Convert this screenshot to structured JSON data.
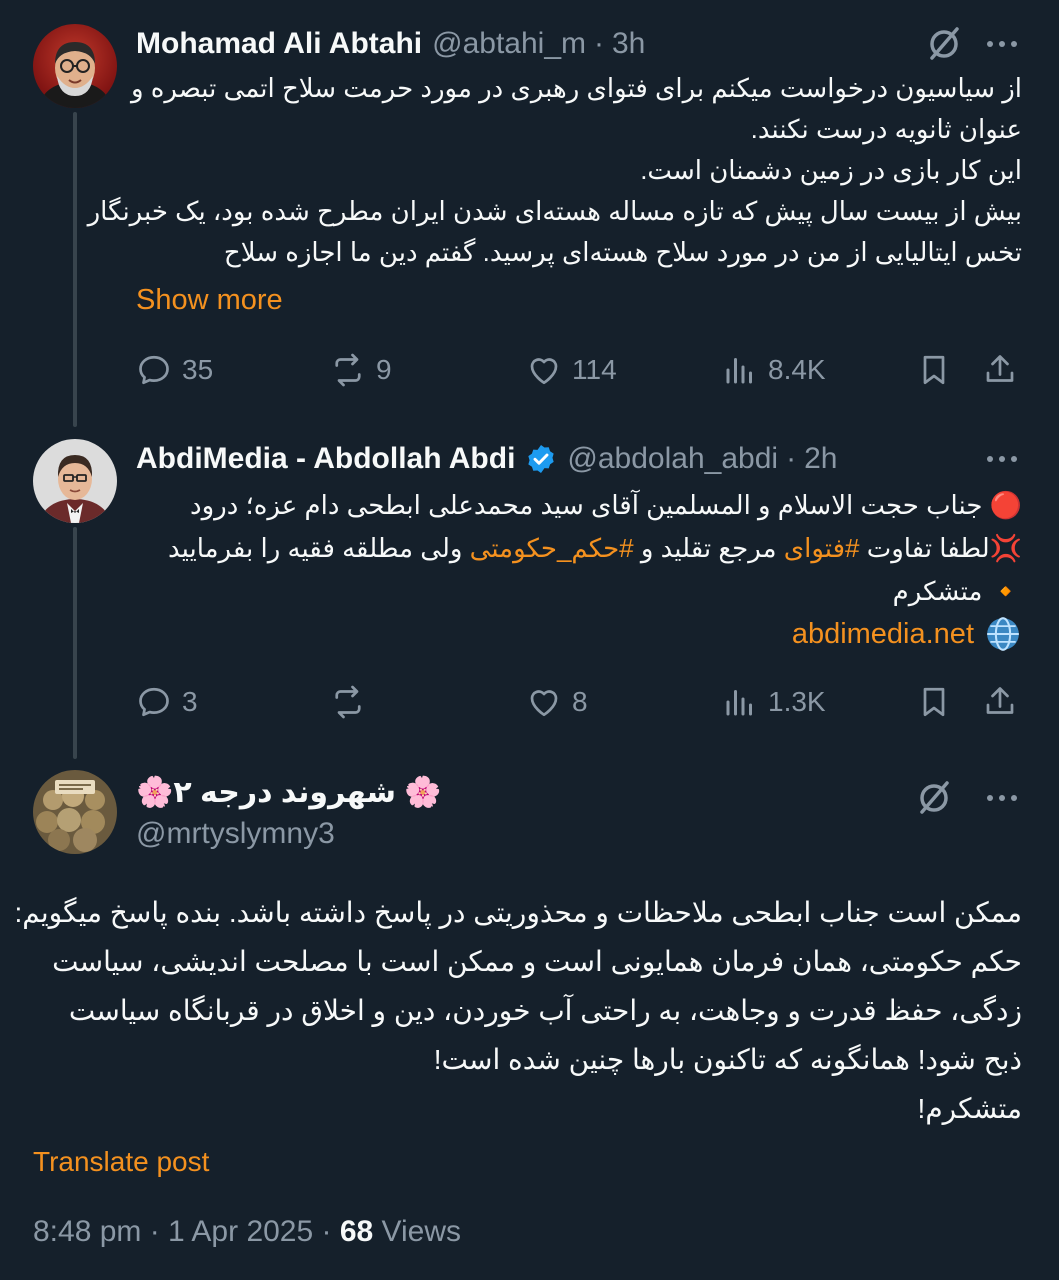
{
  "tweets": [
    {
      "name": "Mohamad Ali Abtahi",
      "handle": "@abtahi_m",
      "time": "3h",
      "body": [
        "از سیاسیون درخواست میکنم برای فتوای رهبری در مورد حرمت سلاح اتمی تبصره و",
        "عنوان ثانویه درست نکنند.",
        "این کار بازی در زمین دشمنان است.",
        "بیش از بیست سال پیش که تازه مساله هسته‌ای شدن ایران مطرح شده بود، یک خبرنگار",
        "تخس ایتالیایی از من در مورد سلاح هسته‌ای پرسید. گفتم دین ما اجازه سلاح"
      ],
      "show_more": "Show more",
      "stats": {
        "replies": "35",
        "reposts": "9",
        "likes": "114",
        "views": "8.4K"
      }
    },
    {
      "name": "AbdiMedia - Abdollah Abdi",
      "handle": "@abdolah_abdi",
      "time": "2h",
      "line1": "🔴 جناب حجت الاسلام و المسلمین آقای سید محمدعلی ابطحی دام عزه؛ درود",
      "line2_prefix": "💢لطفا تفاوت ",
      "hashtag1": "#فتوای",
      "line2_mid": " مرجع تقلید و ",
      "hashtag2": "#حکم_حکومتی",
      "line2_suffix": " ولی مطلقه فقیه را بفرمایید",
      "line3": "🔸 متشکرم",
      "link": "abdimedia.net",
      "stats": {
        "replies": "3",
        "reposts": "",
        "likes": "8",
        "views": "1.3K"
      }
    },
    {
      "name": "🌸شهروند درجه ۲ 🌸",
      "handle": "@mrtyslymny3",
      "body": [
        "ممکن است جناب ابطحی ملاحظات و محذوریتی در پاسخ داشته باشد. بنده پاسخ میگویم:",
        "حکم حکومتی، همان فرمان همایونی است و ممکن است با مصلحت اندیشی، سیاست",
        "زدگی، حفظ قدرت و وجاهت، به راحتی آب خوردن، دین و اخلاق در قربانگاه سیاست",
        "ذبح شود! همانگونه که تاکنون بارها چنین شده است!",
        "متشکرم!"
      ],
      "translate": "Translate post",
      "timestamp": "8:48 pm · 1 Apr 2025 · ",
      "views_count": "68",
      "views_label": " Views"
    }
  ],
  "separator": "·",
  "colors": {
    "background": "#15202b",
    "accent": "#f4911f",
    "muted": "#8b98a5",
    "verified": "#1d9bf0"
  },
  "icons": [
    "more-icon",
    "grok-icon",
    "reply-icon",
    "repost-icon",
    "like-icon",
    "views-icon",
    "bookmark-icon",
    "share-icon",
    "verified-icon",
    "globe-icon"
  ]
}
